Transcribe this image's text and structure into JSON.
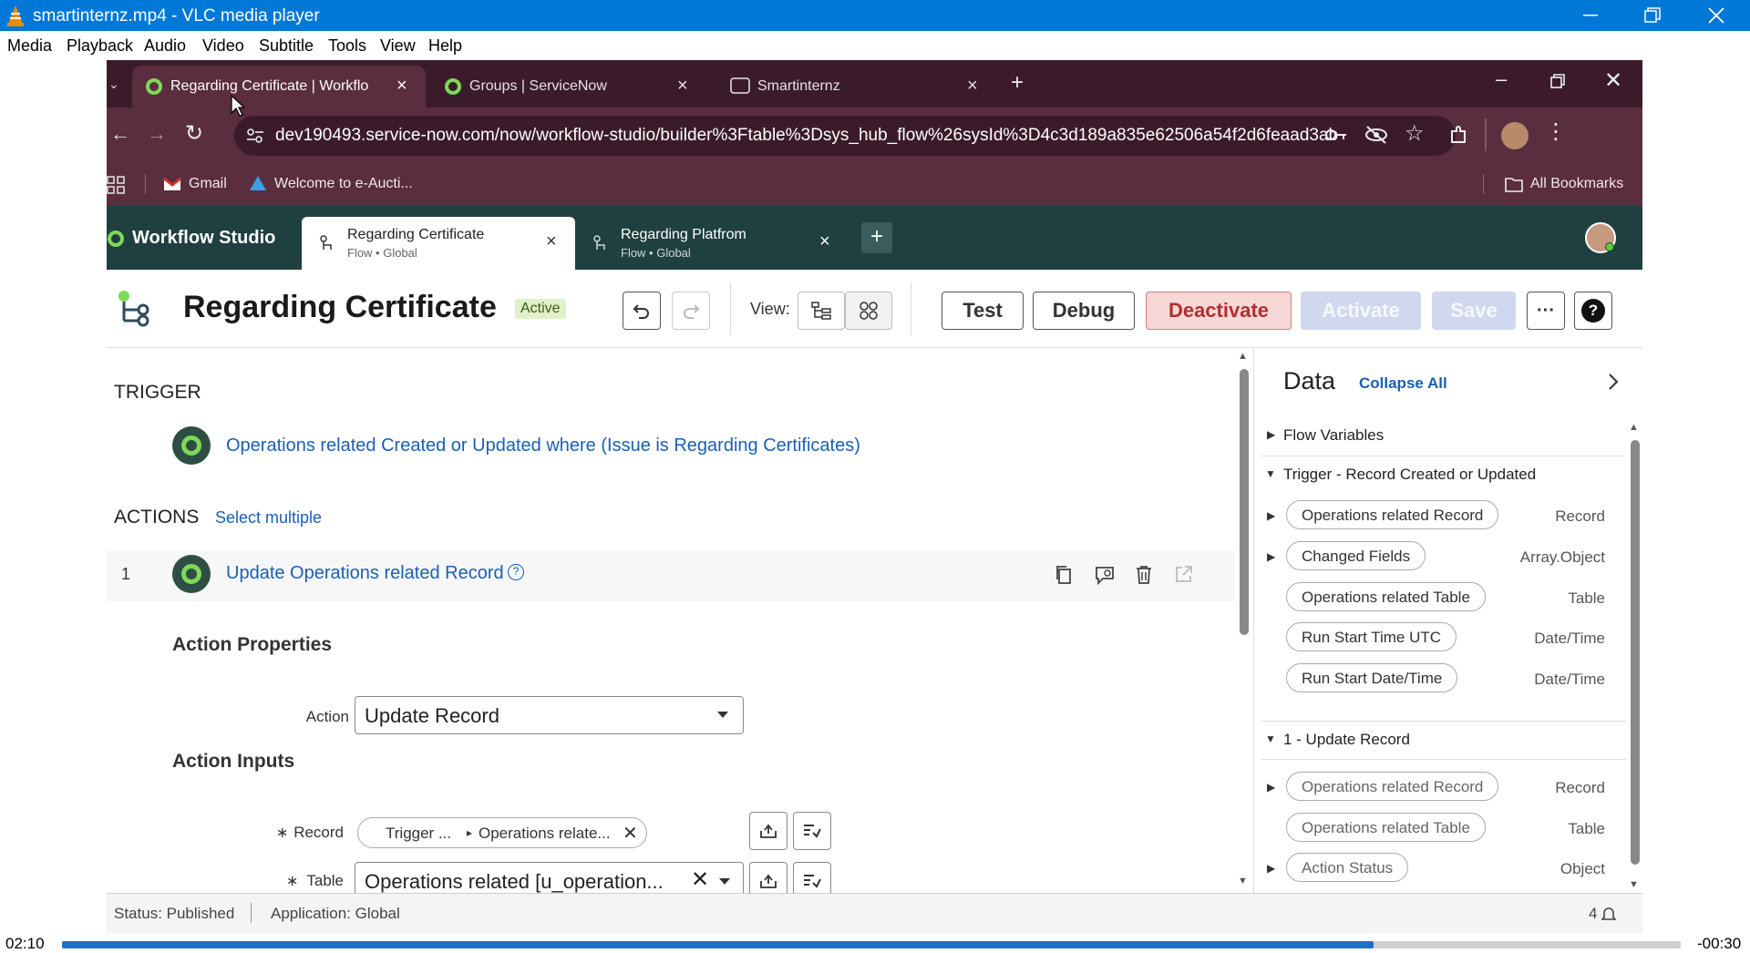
{
  "vlc": {
    "title": "smartinternz.mp4 - VLC media player",
    "menu": [
      "Media",
      "Playback",
      "Audio",
      "Video",
      "Subtitle",
      "Tools",
      "View",
      "Help"
    ],
    "time_elapsed": "02:10",
    "time_remaining": "-00:30",
    "progress_fraction": 0.81
  },
  "chrome": {
    "tabs": [
      {
        "label": "Regarding Certificate | Workflo"
      },
      {
        "label": "Groups | ServiceNow"
      },
      {
        "label": "Smartinternz"
      }
    ],
    "url": "dev190493.service-now.com/now/workflow-studio/builder%3Ftable%3Dsys_hub_flow%26sysId%3D4c3d189a835e62506a54f2d6feaad3ab",
    "bookmarks": [
      "Gmail",
      "Welcome to e-Aucti..."
    ],
    "all_bookmarks": "All Bookmarks"
  },
  "studio": {
    "brand": "Workflow Studio",
    "tabs": [
      {
        "name": "Regarding Certificate",
        "sub": "Flow • Global"
      },
      {
        "name": "Regarding Platfrom",
        "sub": "Flow • Global"
      }
    ]
  },
  "flow": {
    "title": "Regarding Certificate",
    "status": "Active",
    "view_label": "View:",
    "buttons": {
      "test": "Test",
      "debug": "Debug",
      "deactivate": "Deactivate",
      "activate": "Activate",
      "save": "Save",
      "more": "···",
      "help": "?"
    }
  },
  "canvas": {
    "trigger_heading": "TRIGGER",
    "trigger_text": "Operations related Created or Updated where (Issue is Regarding Certificates)",
    "actions_heading": "ACTIONS",
    "select_multiple": "Select multiple",
    "action_number": "1",
    "action_title": "Update Operations related Record",
    "props_heading": "Action Properties",
    "action_label": "Action",
    "action_value": "Update Record",
    "inputs_heading": "Action Inputs",
    "record_label": "Record",
    "record_pill_a": "Trigger ...",
    "record_pill_b": "Operations relate...",
    "table_label": "Table",
    "table_value": "Operations related [u_operation..."
  },
  "data_panel": {
    "title": "Data",
    "collapse_all": "Collapse All",
    "flow_variables": "Flow Variables",
    "trigger_group": "Trigger - Record Created or Updated",
    "trigger_items": [
      {
        "name": "Operations related Record",
        "type": "Record"
      },
      {
        "name": "Changed Fields",
        "type": "Array.Object"
      },
      {
        "name": "Operations related Table",
        "type": "Table"
      },
      {
        "name": "Run Start Time UTC",
        "type": "Date/Time"
      },
      {
        "name": "Run Start Date/Time",
        "type": "Date/Time"
      }
    ],
    "update_group": "1 - Update Record",
    "update_items": [
      {
        "name": "Operations related Record",
        "type": "Record"
      },
      {
        "name": "Operations related Table",
        "type": "Table"
      },
      {
        "name": "Action Status",
        "type": "Object"
      }
    ]
  },
  "status_bar": {
    "status": "Status: Published",
    "application": "Application: Global",
    "notifications": "4"
  }
}
